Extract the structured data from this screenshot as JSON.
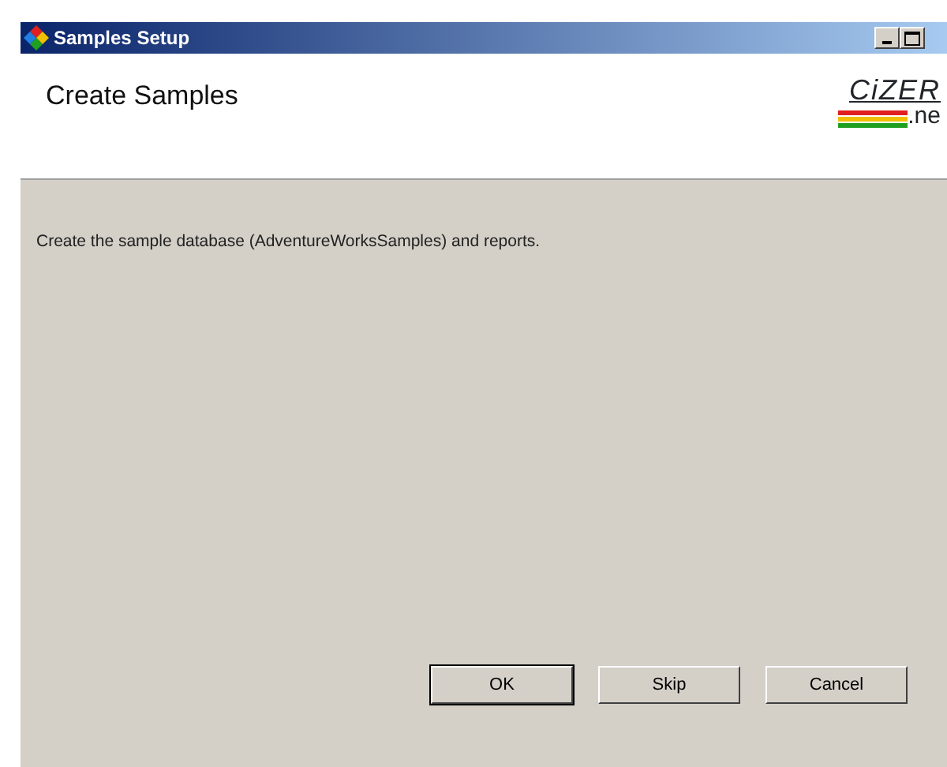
{
  "window": {
    "title": "Samples Setup"
  },
  "header": {
    "title": "Create Samples",
    "logo": {
      "name": "CiZER",
      "suffix": ".ne"
    }
  },
  "message": "Create the sample database (AdventureWorksSamples) and reports.",
  "buttons": [
    {
      "label": "OK",
      "default": true
    },
    {
      "label": "Skip",
      "default": false
    },
    {
      "label": "Cancel",
      "default": false
    }
  ]
}
